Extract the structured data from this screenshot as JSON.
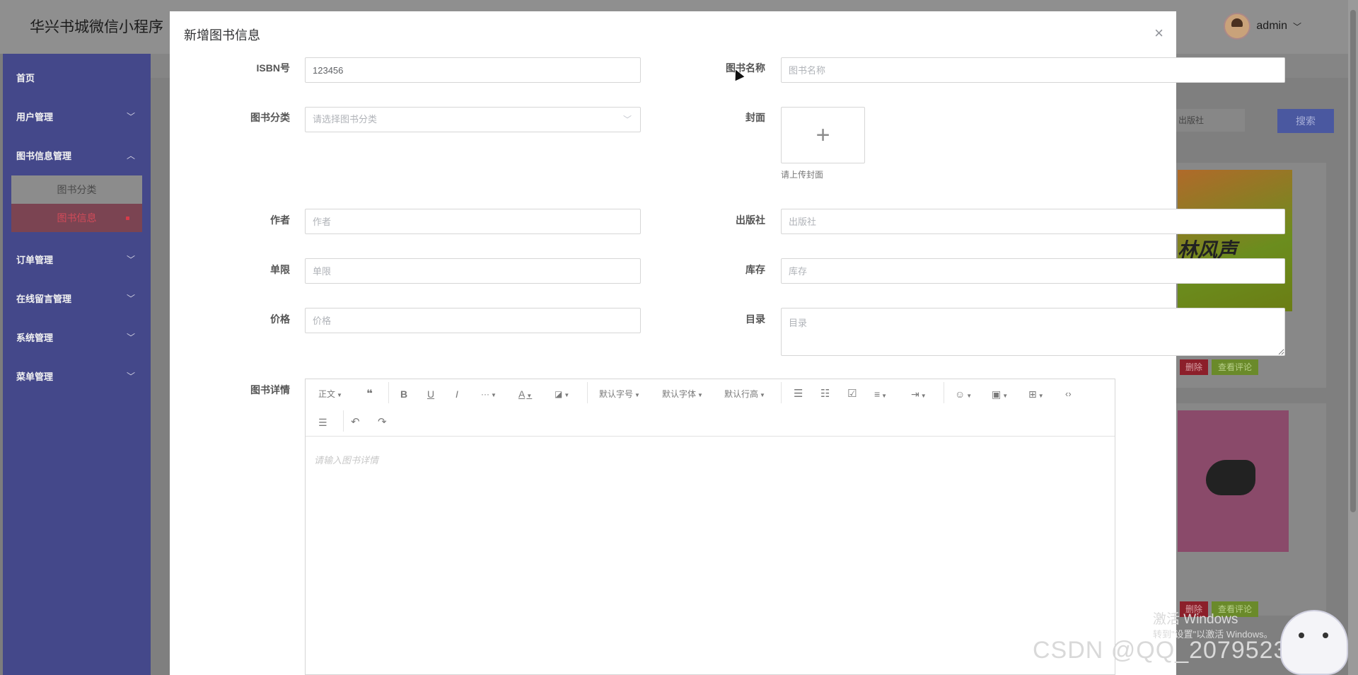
{
  "app": {
    "title": "华兴书城微信小程序",
    "user": "admin",
    "user_caret": "﹀"
  },
  "sidebar": {
    "items": [
      {
        "label": "首页",
        "chevron": ""
      },
      {
        "label": "用户管理",
        "chevron": "﹀"
      },
      {
        "label": "图书信息管理",
        "chevron": "︿"
      },
      {
        "label": "订单管理",
        "chevron": "﹀"
      },
      {
        "label": "在线留言管理",
        "chevron": "﹀"
      },
      {
        "label": "系统管理",
        "chevron": "﹀"
      },
      {
        "label": "菜单管理",
        "chevron": "﹀"
      }
    ],
    "subitems": [
      {
        "label": "图书分类"
      },
      {
        "label": "图书信息"
      }
    ]
  },
  "background": {
    "search_placeholder": "出版社",
    "search_button": "搜索",
    "card1": {
      "title_text": "林风声",
      "delete": "删除",
      "comments": "查看评论"
    },
    "card2": {
      "delete": "删除",
      "comments": "查看评论"
    }
  },
  "modal": {
    "title": "新增图书信息",
    "close": "×",
    "fields": {
      "isbn": {
        "label": "ISBN号",
        "value": "123456"
      },
      "name": {
        "label": "图书名称",
        "placeholder": "图书名称"
      },
      "category": {
        "label": "图书分类",
        "placeholder": "请选择图书分类"
      },
      "cover": {
        "label": "封面",
        "hint": "请上传封面"
      },
      "author": {
        "label": "作者",
        "placeholder": "作者"
      },
      "publisher": {
        "label": "出版社",
        "placeholder": "出版社"
      },
      "limit": {
        "label": "单限",
        "placeholder": "单限"
      },
      "stock": {
        "label": "库存",
        "placeholder": "库存"
      },
      "price": {
        "label": "价格",
        "placeholder": "价格"
      },
      "toc": {
        "label": "目录",
        "placeholder": "目录"
      },
      "details": {
        "label": "图书详情",
        "placeholder": "请输入图书详情"
      }
    },
    "toolbar": {
      "paragraph": "正文",
      "font_size": "默认字号",
      "font_family": "默认字体",
      "line_height": "默认行高"
    }
  },
  "watermark": {
    "activate_title": "激活 Windows",
    "activate_sub": "转到\"设置\"以激活 Windows。",
    "csdn": "CSDN @QQ_2079523550"
  }
}
